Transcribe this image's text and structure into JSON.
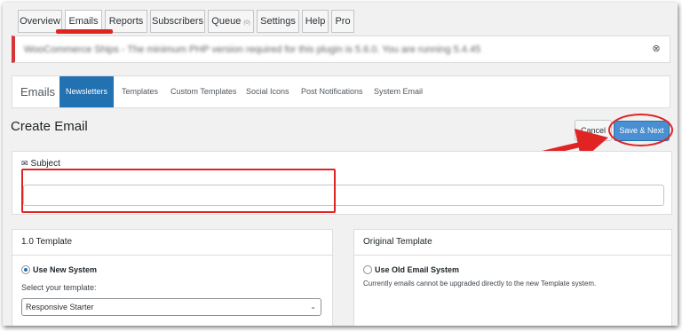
{
  "top_tabs": [
    {
      "label": "Overview",
      "count": ""
    },
    {
      "label": "Emails",
      "count": ""
    },
    {
      "label": "Reports",
      "count": ""
    },
    {
      "label": "Subscribers",
      "count": ""
    },
    {
      "label": "Queue",
      "count": "(0)"
    },
    {
      "label": "Settings",
      "count": ""
    },
    {
      "label": "Help",
      "count": ""
    },
    {
      "label": "Pro",
      "count": ""
    }
  ],
  "notice": {
    "text": "WooCommerce Ships - The minimum PHP version required for this plugin is 5.6.0. You are running 5.4.45",
    "close_icon": "⊗"
  },
  "subnav": {
    "title": "Emails",
    "items": [
      "Newsletters",
      "Templates",
      "Custom Templates",
      "Social Icons",
      "Post Notifications",
      "System Email"
    ]
  },
  "page": {
    "title": "Create Email",
    "cancel_label": "Cancel",
    "save_label": "Save & Next"
  },
  "subject": {
    "icon": "✉",
    "label": "Subject",
    "value": ""
  },
  "template_new": {
    "heading": "1.0 Template",
    "radio_label": "Use New System",
    "select_label": "Select your template:",
    "select_value": "Responsive Starter",
    "chevron": "⌄"
  },
  "template_old": {
    "heading": "Original Template",
    "radio_label": "Use Old Email System",
    "note": "Currently emails cannot be upgraded directly to the new Template system."
  },
  "colors": {
    "accent": "#2271b1",
    "annotation": "#e02424"
  }
}
